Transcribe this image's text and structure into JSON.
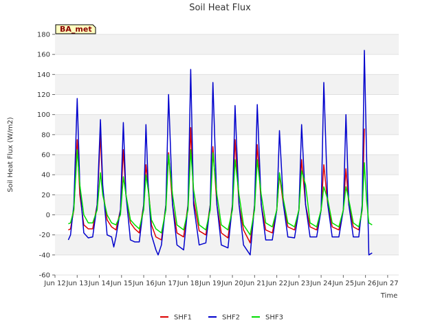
{
  "chart_data": {
    "type": "line",
    "title": "Soil Heat Flux",
    "xlabel": "Time",
    "ylabel": "Soil Heat Flux (W/m2)",
    "site_label": "BA_met",
    "ylim": [
      -60,
      180
    ],
    "yticks": [
      -60,
      -40,
      -20,
      0,
      20,
      40,
      60,
      80,
      100,
      120,
      140,
      160,
      180
    ],
    "xlim": [
      11.5,
      27
    ],
    "xticks": [
      {
        "x": 11.5,
        "label": "Jun 12"
      },
      {
        "x": 12.5,
        "label": "Jun 13"
      },
      {
        "x": 13.5,
        "label": "Jun 14"
      },
      {
        "x": 14.5,
        "label": "Jun 15"
      },
      {
        "x": 15.5,
        "label": "Jun 16"
      },
      {
        "x": 16.5,
        "label": "Jun 17"
      },
      {
        "x": 17.5,
        "label": "Jun 18"
      },
      {
        "x": 18.5,
        "label": "Jun 19"
      },
      {
        "x": 19.5,
        "label": "Jun 20"
      },
      {
        "x": 20.5,
        "label": "Jun 21"
      },
      {
        "x": 21.5,
        "label": "Jun 22"
      },
      {
        "x": 22.5,
        "label": "Jun 23"
      },
      {
        "x": 23.5,
        "label": "Jun 24"
      },
      {
        "x": 24.5,
        "label": "Jun 25"
      },
      {
        "x": 25.5,
        "label": "Jun 26"
      },
      {
        "x": 26.5,
        "label": "Jun 27"
      }
    ],
    "grid": true,
    "legend_position": "bottom-center",
    "series": [
      {
        "name": "SHF1",
        "color": "#dd0000",
        "x": [
          12.1,
          12.2,
          12.35,
          12.5,
          12.62,
          12.8,
          13.0,
          13.2,
          13.4,
          13.55,
          13.65,
          13.85,
          14.05,
          14.25,
          14.45,
          14.58,
          14.7,
          14.9,
          15.1,
          15.3,
          15.5,
          15.6,
          15.7,
          15.85,
          16.05,
          16.3,
          16.5,
          16.62,
          16.8,
          17.0,
          17.3,
          17.5,
          17.62,
          17.75,
          18.0,
          18.3,
          18.5,
          18.62,
          18.8,
          19.0,
          19.3,
          19.5,
          19.62,
          19.8,
          20.0,
          20.3,
          20.5,
          20.62,
          20.8,
          21.0,
          21.3,
          21.5,
          21.62,
          21.8,
          22.0,
          22.3,
          22.5,
          22.62,
          22.8,
          23.0,
          23.3,
          23.5,
          23.62,
          23.8,
          24.0,
          24.3,
          24.5,
          24.62,
          24.75,
          24.95,
          25.2,
          25.35,
          25.45
        ],
        "y": [
          -15,
          -14,
          5,
          75,
          20,
          -10,
          -14,
          -14,
          10,
          80,
          25,
          -5,
          -12,
          -15,
          5,
          65,
          20,
          -8,
          -14,
          -18,
          10,
          50,
          30,
          -10,
          -22,
          -25,
          10,
          62,
          10,
          -18,
          -22,
          10,
          87,
          15,
          -16,
          -20,
          10,
          68,
          10,
          -18,
          -23,
          10,
          75,
          10,
          -15,
          -28,
          10,
          70,
          10,
          -15,
          -18,
          5,
          40,
          10,
          -12,
          -15,
          5,
          55,
          10,
          -12,
          -15,
          5,
          50,
          10,
          -12,
          -15,
          5,
          46,
          10,
          -12,
          -15,
          5,
          86
        ]
      },
      {
        "name": "SHF2",
        "color": "#0000cc",
        "x": [
          12.1,
          12.2,
          12.35,
          12.5,
          12.62,
          12.8,
          13.0,
          13.2,
          13.4,
          13.55,
          13.65,
          13.85,
          14.05,
          14.15,
          14.25,
          14.45,
          14.58,
          14.7,
          14.9,
          15.1,
          15.3,
          15.5,
          15.6,
          15.7,
          15.85,
          16.05,
          16.15,
          16.3,
          16.5,
          16.62,
          16.8,
          17.0,
          17.3,
          17.5,
          17.62,
          17.75,
          18.0,
          18.3,
          18.5,
          18.62,
          18.8,
          19.0,
          19.3,
          19.5,
          19.62,
          19.8,
          20.0,
          20.3,
          20.5,
          20.62,
          20.8,
          21.0,
          21.3,
          21.5,
          21.62,
          21.8,
          22.0,
          22.3,
          22.5,
          22.62,
          22.8,
          23.0,
          23.3,
          23.5,
          23.62,
          23.8,
          24.0,
          24.3,
          24.5,
          24.62,
          24.75,
          24.95,
          25.2,
          25.35,
          25.45,
          25.55,
          25.65,
          25.8
        ],
        "y": [
          -25,
          -20,
          10,
          116,
          30,
          -18,
          -23,
          -22,
          10,
          95,
          30,
          -20,
          -22,
          -32,
          -22,
          5,
          92,
          20,
          -25,
          -27,
          -27,
          10,
          90,
          30,
          -20,
          -35,
          -40,
          -30,
          10,
          120,
          10,
          -30,
          -35,
          10,
          145,
          10,
          -30,
          -28,
          10,
          132,
          10,
          -30,
          -33,
          10,
          109,
          10,
          -30,
          -40,
          10,
          110,
          10,
          -25,
          -25,
          5,
          84,
          10,
          -22,
          -23,
          5,
          90,
          10,
          -22,
          -22,
          5,
          132,
          10,
          -22,
          -22,
          5,
          100,
          10,
          -22,
          -22,
          10,
          164,
          60,
          -40,
          -38
        ]
      },
      {
        "name": "SHF3",
        "color": "#00dd00",
        "x": [
          12.1,
          12.2,
          12.35,
          12.5,
          12.62,
          12.8,
          13.0,
          13.2,
          13.4,
          13.55,
          13.65,
          13.85,
          14.05,
          14.25,
          14.45,
          14.58,
          14.7,
          14.9,
          15.1,
          15.3,
          15.5,
          15.6,
          15.7,
          15.85,
          16.05,
          16.3,
          16.5,
          16.62,
          16.8,
          17.0,
          17.3,
          17.5,
          17.62,
          17.75,
          18.0,
          18.3,
          18.5,
          18.62,
          18.8,
          19.0,
          19.3,
          19.5,
          19.62,
          19.8,
          20.0,
          20.3,
          20.5,
          20.62,
          20.8,
          21.0,
          21.3,
          21.5,
          21.62,
          21.8,
          22.0,
          22.3,
          22.5,
          22.62,
          22.8,
          23.0,
          23.3,
          23.5,
          23.62,
          23.8,
          24.0,
          24.3,
          24.5,
          24.62,
          24.75,
          24.95,
          25.2,
          25.35,
          25.45,
          25.55,
          25.65,
          25.8
        ],
        "y": [
          -9,
          -8,
          5,
          65,
          30,
          0,
          -8,
          -8,
          5,
          42,
          20,
          0,
          -8,
          -10,
          0,
          38,
          20,
          -5,
          -10,
          -14,
          5,
          40,
          25,
          -5,
          -14,
          -18,
          5,
          60,
          20,
          -10,
          -15,
          5,
          65,
          25,
          -10,
          -15,
          5,
          62,
          20,
          -10,
          -15,
          5,
          55,
          20,
          -10,
          -20,
          5,
          55,
          20,
          -8,
          -12,
          5,
          42,
          15,
          -8,
          -12,
          5,
          44,
          30,
          -8,
          -12,
          5,
          28,
          15,
          -8,
          -12,
          5,
          28,
          15,
          -8,
          -12,
          5,
          52,
          15,
          -8,
          -10
        ]
      }
    ]
  }
}
